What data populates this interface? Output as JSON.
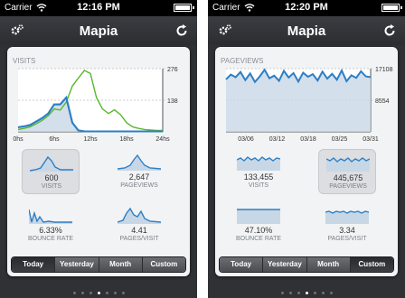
{
  "status": {
    "carrier": "Carrier"
  },
  "nav": {
    "title": "Mapia",
    "left_icon": "gear-icon",
    "right_icon": "refresh-icon"
  },
  "colors": {
    "accent_blue": "#2c7fc6",
    "green_line": "#5ab82a",
    "fill_blue": "#c8d7e6"
  },
  "segments": [
    "Today",
    "Yesterday",
    "Month",
    "Custom"
  ],
  "screens": [
    {
      "time": "12:16 PM",
      "selected_segment": "Today",
      "page_index": 3,
      "chart": {
        "title": "VISITS",
        "y_max_label": "276",
        "y_mid_label": "138",
        "x_labels": [
          "0hs",
          "6hs",
          "12hs",
          "18hs",
          "24hs"
        ]
      },
      "chart_data": {
        "type": "line",
        "x": [
          0,
          1,
          2,
          3,
          4,
          5,
          6,
          7,
          8,
          9,
          10,
          11,
          12,
          13,
          14,
          15,
          16,
          17,
          18,
          19,
          20,
          21,
          22,
          23,
          24
        ],
        "ylim": [
          0,
          276
        ],
        "series": [
          {
            "values": [
              20,
              24,
              30,
              45,
              60,
              80,
              120,
              120,
              150,
              40,
              6,
              2,
              2,
              2,
              2,
              2,
              2,
              2,
              2,
              2,
              2,
              2,
              2,
              2,
              2
            ]
          },
          {
            "values": [
              10,
              15,
              22,
              35,
              50,
              70,
              100,
              95,
              130,
              200,
              235,
              268,
              255,
              150,
              100,
              80,
              96,
              75,
              40,
              22,
              15,
              10,
              8,
              6,
              6
            ]
          }
        ]
      },
      "tiles": [
        {
          "value": "600",
          "label": "VISITS",
          "selected": true
        },
        {
          "value": "2,647",
          "label": "PAGEVIEWS",
          "selected": false
        },
        {
          "value": "6.33%",
          "label": "BOUNCE RATE",
          "selected": false
        },
        {
          "value": "4.41",
          "label": "PAGES/VISIT",
          "selected": false
        }
      ]
    },
    {
      "time": "12:20 PM",
      "selected_segment": "Custom",
      "page_index": 3,
      "chart": {
        "title": "PAGEVIEWS",
        "y_max_label": "17108",
        "y_mid_label": "8554",
        "x_labels": [
          "03/06",
          "03/12",
          "03/18",
          "03/25",
          "03/31"
        ]
      },
      "chart_data": {
        "type": "area",
        "x": [
          1,
          2,
          3,
          4,
          5,
          6,
          7,
          8,
          9,
          10,
          11,
          12,
          13,
          14,
          15,
          16,
          17,
          18,
          19,
          20,
          21,
          22,
          23,
          24,
          25,
          26,
          27,
          28,
          29,
          30,
          31
        ],
        "ylim": [
          0,
          17108
        ],
        "series": [
          {
            "values": [
              14200,
              15500,
              14800,
              16200,
              14000,
              15800,
              13500,
              15000,
              16800,
              14500,
              15200,
              13800,
              16500,
              14700,
              15900,
              13600,
              16000,
              14900,
              15600,
              13900,
              16300,
              14400,
              15700,
              14100,
              16600,
              13700,
              15300,
              14600,
              16400,
              15000,
              14800
            ]
          }
        ]
      },
      "tiles": [
        {
          "value": "133,455",
          "label": "VISITS",
          "selected": false
        },
        {
          "value": "445,675",
          "label": "PAGEVIEWS",
          "selected": true
        },
        {
          "value": "47.10%",
          "label": "BOUNCE RATE",
          "selected": false
        },
        {
          "value": "3.34",
          "label": "PAGES/VISIT",
          "selected": false
        }
      ]
    }
  ]
}
